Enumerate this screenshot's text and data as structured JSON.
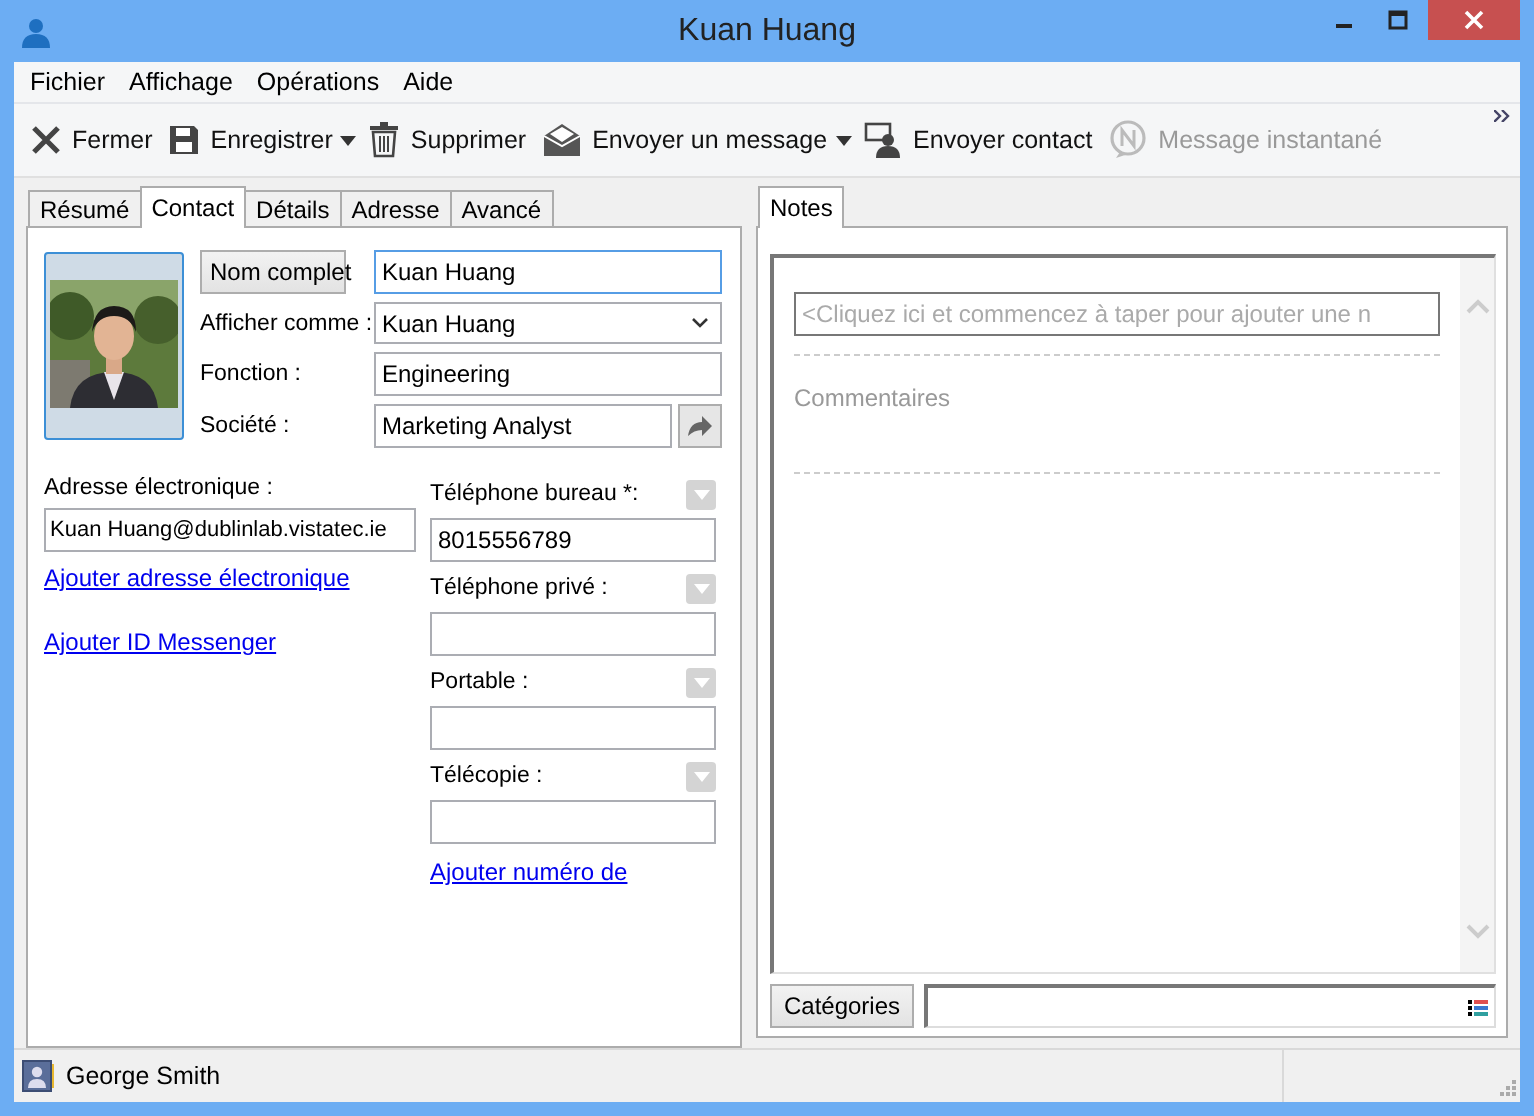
{
  "window": {
    "title": "Kuan Huang"
  },
  "menu": [
    "Fichier",
    "Affichage",
    "Opérations",
    "Aide"
  ],
  "toolbar": [
    {
      "label": "Fermer",
      "kind": "close",
      "has_menu": false,
      "disabled": false
    },
    {
      "label": "Enregistrer",
      "kind": "save",
      "has_menu": true,
      "disabled": false
    },
    {
      "label": "Supprimer",
      "kind": "delete",
      "has_menu": false,
      "disabled": false
    },
    {
      "label": "Envoyer un message",
      "kind": "mail",
      "has_menu": true,
      "disabled": false
    },
    {
      "label": "Envoyer contact",
      "kind": "contact",
      "has_menu": false,
      "disabled": false
    },
    {
      "label": "Message instantané",
      "kind": "chat",
      "has_menu": false,
      "disabled": true
    }
  ],
  "tabs": [
    {
      "label": "Résumé",
      "selected": false
    },
    {
      "label": "Contact",
      "selected": true
    },
    {
      "label": "Détails",
      "selected": false
    },
    {
      "label": "Adresse",
      "selected": false
    },
    {
      "label": "Avancé",
      "selected": false
    }
  ],
  "name_fields": [
    {
      "kind": "button",
      "label": "Nom complet",
      "value": "Kuan Huang"
    },
    {
      "kind": "dropdown",
      "label": "Afficher comme :",
      "value": "Kuan Huang"
    },
    {
      "kind": "text",
      "label": "Fonction :",
      "value": "Engineering"
    },
    {
      "kind": "link",
      "label": "Société :",
      "value": "Marketing Analyst"
    }
  ],
  "email": {
    "label": "Adresse électronique :",
    "value": "Kuan Huang@dublinlab.vistatec.ie",
    "links": [
      "Ajouter adresse électronique",
      "Ajouter ID Messenger"
    ]
  },
  "phones": [
    {
      "label": "Téléphone bureau *:",
      "value": "8015556789"
    },
    {
      "label": "Téléphone privé :"
    },
    {
      "label": "Portable :"
    },
    {
      "label": "Télécopie :"
    }
  ],
  "phone_link": "Ajouter numéro de",
  "notes": {
    "tab": "Notes",
    "placeholder": "<Cliquez ici et commencez à taper pour ajouter une n",
    "comments_label": "Commentaires",
    "categories_button": "Catégories"
  },
  "status_bar": {
    "user": "George Smith"
  }
}
